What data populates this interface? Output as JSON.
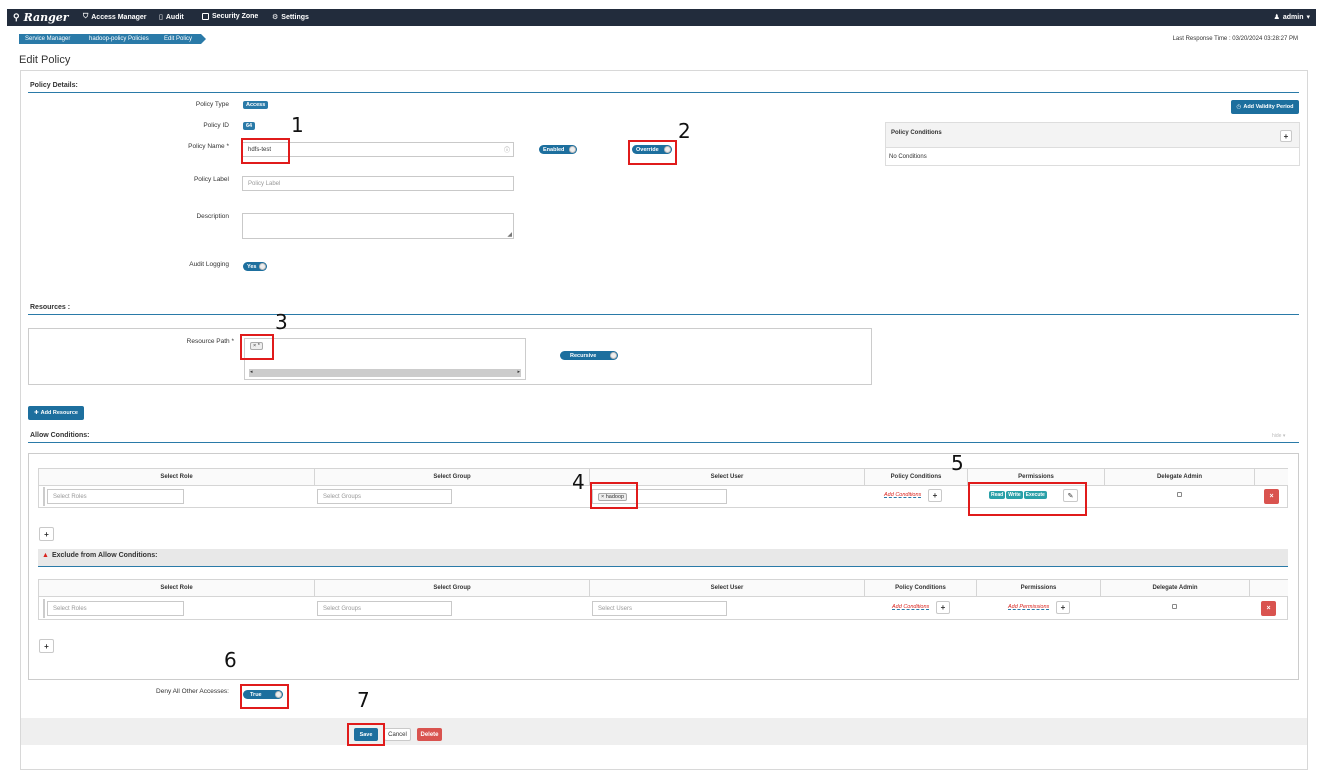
{
  "navbar": {
    "brand": "Ranger",
    "items": [
      "Access Manager",
      "Audit",
      "Security Zone",
      "Settings"
    ],
    "user": "admin"
  },
  "breadcrumb": [
    "Service Manager",
    "hadoop-policy Policies",
    "Edit Policy"
  ],
  "last_response": "Last Response Time : 03/20/2024 03:28:27 PM",
  "page_title": "Edit Policy",
  "policy_details": {
    "heading": "Policy Details:",
    "policy_type_label": "Policy Type",
    "policy_type": "Access",
    "policy_id_label": "Policy ID",
    "policy_id": "64",
    "policy_name_label": "Policy Name *",
    "policy_name": "hdfs-test",
    "enabled": "Enabled",
    "override": "Override",
    "policy_label_label": "Policy Label",
    "policy_label_placeholder": "Policy Label",
    "description_label": "Description",
    "audit_logging_label": "Audit Logging",
    "audit_logging": "Yes",
    "add_validity": "Add Validity Period",
    "conditions_title": "Policy Conditions",
    "no_conditions": "No Conditions"
  },
  "resources": {
    "heading": "Resources :",
    "path_label": "Resource Path *",
    "path_value": "*",
    "recursive": "Recursive",
    "add_resource": "Add Resource"
  },
  "allow": {
    "heading": "Allow Conditions:",
    "hide": "hide",
    "columns": [
      "Select Role",
      "Select Group",
      "Select User",
      "Policy Conditions",
      "Permissions",
      "Delegate Admin"
    ],
    "roles_placeholder": "Select Roles",
    "groups_placeholder": "Select Groups",
    "user": "hadoop",
    "add_conditions": "Add Conditions",
    "permissions": [
      "Read",
      "Write",
      "Execute"
    ]
  },
  "exclude": {
    "heading": "Exclude from Allow Conditions:",
    "columns": [
      "Select Role",
      "Select Group",
      "Select User",
      "Policy Conditions",
      "Permissions",
      "Delegate Admin"
    ],
    "roles_placeholder": "Select Roles",
    "groups_placeholder": "Select Groups",
    "users_placeholder": "Select Users",
    "add_conditions": "Add Conditions",
    "add_permissions": "Add Permissions"
  },
  "deny_all": {
    "label": "Deny All Other Accesses:",
    "value": "True"
  },
  "actions": {
    "save": "Save",
    "cancel": "Cancel",
    "delete": "Delete"
  },
  "callouts": [
    "1",
    "2",
    "3",
    "4",
    "5",
    "6",
    "7"
  ]
}
